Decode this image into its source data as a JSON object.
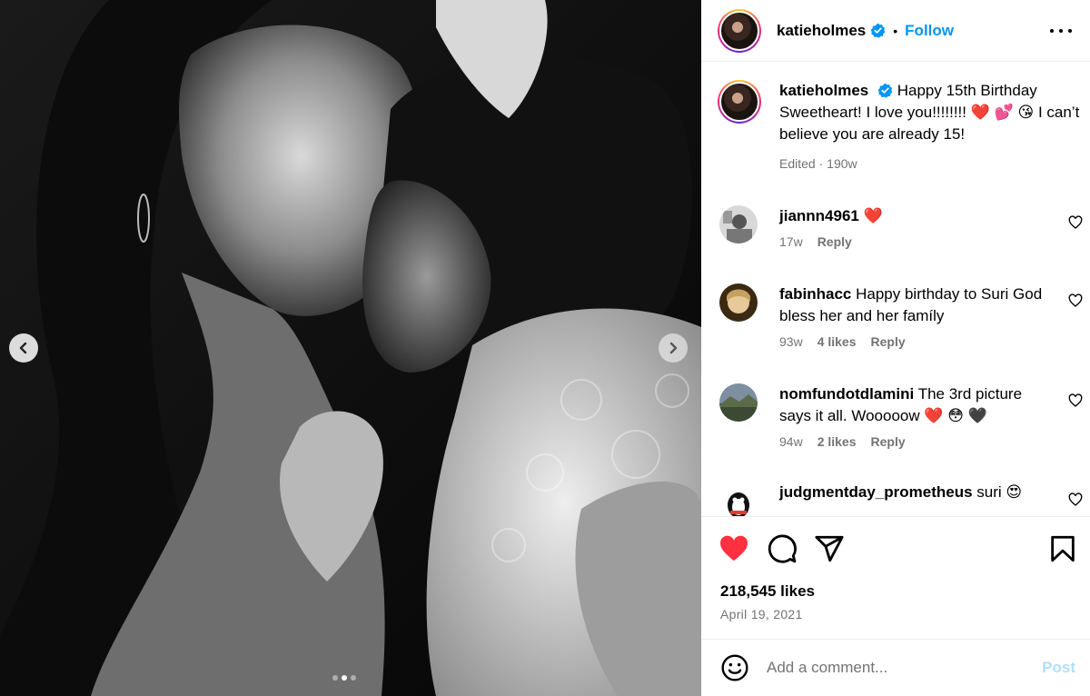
{
  "post": {
    "username": "katieholmes",
    "follow_label": "Follow",
    "separator": "•"
  },
  "caption": {
    "username": "katieholmes",
    "text": "Happy 15th Birthday Sweetheart! I love you!!!!!!!! ❤️ 💕 😘 I can’t believe you are already 15!",
    "edited": "Edited",
    "time": "190w"
  },
  "comments": [
    {
      "username": "jiannn4961",
      "text": "❤️",
      "time": "17w",
      "likes": "",
      "reply": "Reply"
    },
    {
      "username": "fabinhacc",
      "text": "Happy birthday to Suri God bless her and her famíly",
      "time": "93w",
      "likes": "4 likes",
      "reply": "Reply"
    },
    {
      "username": "nomfundotdlamini",
      "text": "The 3rd picture says it all. Wooooow ❤️ 😳 🖤",
      "time": "94w",
      "likes": "2 likes",
      "reply": "Reply"
    },
    {
      "username": "judgmentday_prometheus",
      "text": "suri 😍",
      "time": "",
      "likes": "",
      "reply": ""
    }
  ],
  "engagement": {
    "likes_label": "218,545 likes",
    "date": "April 19, 2021"
  },
  "compose": {
    "placeholder": "Add a comment...",
    "post_label": "Post"
  },
  "carousel": {
    "current_index": 2,
    "total": 3
  },
  "colors": {
    "accent": "#0095f6",
    "like_red": "#ff3040",
    "muted": "#737373",
    "post_disabled": "#b2dffc"
  },
  "icons": [
    "verified-badge-icon",
    "more-options-icon",
    "heart-icon",
    "comment-icon",
    "share-icon",
    "bookmark-icon",
    "emoji-icon",
    "chevron-left-icon",
    "chevron-right-icon"
  ]
}
